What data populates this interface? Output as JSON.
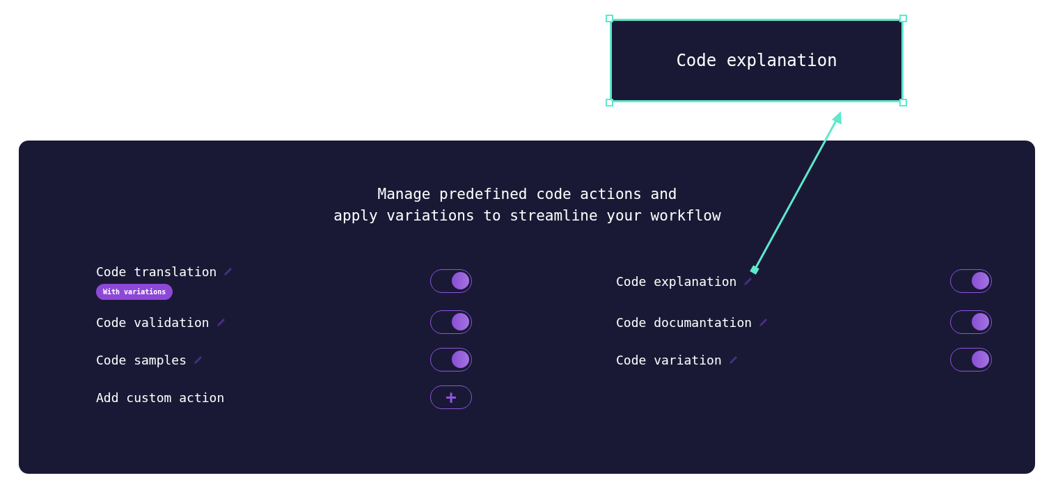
{
  "callout": {
    "text": "Code explanation",
    "selected": true
  },
  "panel": {
    "heading": [
      "Manage predefined code actions and",
      "apply variations to streamline your workflow"
    ],
    "columns": [
      {
        "items": [
          {
            "kind": "toggle",
            "label": "Code translation",
            "badge": "With variations",
            "on": true
          },
          {
            "kind": "toggle",
            "label": "Code validation",
            "on": true
          },
          {
            "kind": "toggle",
            "label": "Code samples",
            "on": true
          },
          {
            "kind": "add",
            "label": "Add custom action",
            "button": "+"
          }
        ]
      },
      {
        "items": [
          {
            "kind": "toggle",
            "label": "Code explanation",
            "on": true
          },
          {
            "kind": "toggle",
            "label": "Code documantation",
            "on": true
          },
          {
            "kind": "toggle",
            "label": "Code variation",
            "on": true
          }
        ]
      }
    ]
  }
}
